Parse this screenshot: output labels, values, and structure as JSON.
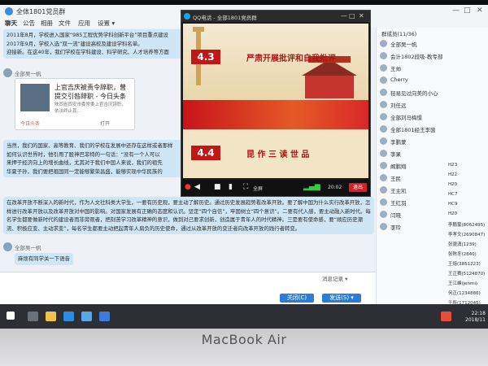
{
  "window": {
    "title": "全体1801党员群",
    "menu": [
      "聊天",
      "公告",
      "相册",
      "文件",
      "应用",
      "设置 ▾"
    ],
    "controls": [
      "—",
      "□",
      "✕"
    ]
  },
  "chat": {
    "top_text_1": "2011年8月，学校进入国家“985工程优势学科创新平台”项目重点建设",
    "top_text_2": "2017年9月，学校入选“双一流”建设高校及建设学科名单。",
    "top_text_3": "迎接新。在这40年，我们学校在学科建设、科学研究、人才培养等方面",
    "sender_1": "全部吴一帆",
    "card": {
      "title": "上官吉庆被责令辞职，曾提交引咎辞职 - 今日头条",
      "desc": "陕西省西安市委常委上官吉庆辞职，依法终止其…",
      "source": "今日头条",
      "open": "打开"
    },
    "mid_text_1": "当然，我们的国家、高等教育、我们的学校在发展中还存在这样或者那样",
    "mid_text_2": "如何认识世界时，他引用了股神巴菲特的一句话：“没有一个人可以",
    "mid_text_3": "来押于经济向上的增长曲线，尤其对于我们中国人来说，我们的祖先",
    "mid_text_4": "华夏子孙，我们要把祖国同一定能够繁荣昌盛，能够实现中华民族的",
    "long_text": "在改革开放不断深入的新时代，作为人文社科类大学生，一要有历史观，要主动了解历史。通过历史发展趋势看改革开放。要了解中国为什么实行改革开放，怎样进行改革开放以及改革开放对中国的影响。对国家发展有正确的态度和认识。坚定“四个自信”，牢固树立“四个意识”。二要有代入感，要主动融入新时代。每名学生都要做新时代的建设者而非旁观者，把刻苦学习改革精神的意识，做到对己要求创新，创造属于青年人的时代精神。三是要有使命感，要“顺应历史潮流、积极应变、主动求变”，每名学生都要主动把起青年人肩负的历史使命，通过从改革开放的变迁者向改革开放的践行者转变。",
    "sender_2": "全部吴一帆",
    "last_msg": "麻烦有同学关一下语音"
  },
  "input": {
    "close_btn": "关闭(C)",
    "send_btn": "发送(S) ▾",
    "history": "消息记录 ▾"
  },
  "sidebar": {
    "title": "群成员(11/36)",
    "members": [
      "全部吴一帆",
      "会计1802段吸-教专部",
      "王帅",
      "Cherry",
      "轻易见过向美的小心",
      "刘任远",
      "全部刘马梅憬",
      "全部1801经王李茵",
      "李鹏蒙",
      "李果",
      "阚鹏翔",
      "王民",
      "王主凯",
      "王红羽",
      "闫晓",
      "李玲"
    ],
    "right_column": [
      "H23",
      "H22",
      "H20",
      "HC7",
      "HC9",
      "H20",
      "李鹏蒙(8062495)",
      "李孝文(2690847)",
      "张骁潇(1239)",
      "张陈冬(2840)",
      "王熔(3851223)",
      "王正赛(5124870)",
      "王江峰(jenmi)",
      "何正(1234886)",
      "于所(1712045)",
      "陈牡禾(1280465)"
    ]
  },
  "popup": {
    "title": "QQ电话 - 全部1801党员群",
    "slide_num_1": "4.3",
    "slide_heading_1": "严肃开展批评和自我批评",
    "slide_num_2": "4.4",
    "slide_heading_2": "昆 作 三 读 世 品",
    "fullscreen": "全屏",
    "timer": "20:02",
    "exit": "退出"
  },
  "taskbar": {
    "time": "22:18",
    "date": "2018/11"
  },
  "bezel": {
    "brand": "MacBook Air"
  }
}
